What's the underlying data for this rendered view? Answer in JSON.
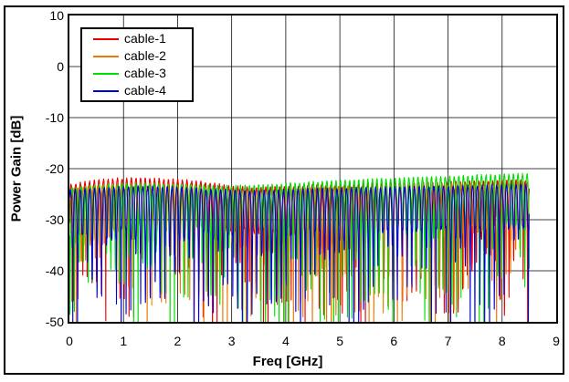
{
  "figure": {
    "background_color": "#ffffff",
    "border_color": "#000000",
    "grid_color": "#000000",
    "text_color": "#000000"
  },
  "chart_data": {
    "type": "line",
    "title": "",
    "xlabel": "Freq [GHz]",
    "ylabel": "Power Gain [dB]",
    "xlim": [
      0,
      9
    ],
    "ylim": [
      -50,
      10
    ],
    "x_ticks": [
      0,
      1,
      2,
      3,
      4,
      5,
      6,
      7,
      8,
      9
    ],
    "y_ticks": [
      10,
      0,
      -10,
      -20,
      -30,
      -40,
      -50
    ],
    "grid": true,
    "legend_position": "top-left",
    "data_x_range_ghz": [
      0,
      8.5
    ],
    "description": "Four cable power-gain traces with dense standing-wave ripple: peaks near -21 to -24 dB, nulls plunging to below -50 dB, ripple period about 0.085 GHz",
    "series": [
      {
        "name": "cable-1",
        "color": "#ee0000",
        "ripple_period_ghz": 0.0857,
        "phase_offset_ghz": 0.012,
        "seed": 101,
        "null_depth_db_range": [
          8,
          33
        ],
        "peak_envelope_db": {
          "x": [
            0,
            0.5,
            1,
            1.5,
            2,
            2.5,
            3,
            3.5,
            4,
            4.5,
            5,
            5.5,
            6,
            6.5,
            7,
            7.5,
            8,
            8.5
          ],
          "y": [
            -23.2,
            -22.3,
            -21.9,
            -22.0,
            -22.2,
            -22.7,
            -23.5,
            -23.8,
            -23.6,
            -23.4,
            -23.2,
            -23.0,
            -22.9,
            -22.8,
            -22.7,
            -22.6,
            -22.4,
            -22.3
          ]
        }
      },
      {
        "name": "cable-2",
        "color": "#f07800",
        "ripple_period_ghz": 0.0873,
        "phase_offset_ghz": 0.047,
        "seed": 202,
        "null_depth_db_range": [
          8,
          33
        ],
        "peak_envelope_db": {
          "x": [
            0,
            0.5,
            1,
            1.5,
            2,
            2.5,
            3,
            3.5,
            4,
            4.5,
            5,
            5.5,
            6,
            6.5,
            7,
            7.5,
            8,
            8.5
          ],
          "y": [
            -24.0,
            -23.5,
            -23.2,
            -23.3,
            -23.4,
            -23.8,
            -24.2,
            -24.3,
            -24.1,
            -23.9,
            -23.7,
            -23.5,
            -23.4,
            -23.2,
            -23.1,
            -23.0,
            -22.9,
            -22.8
          ]
        }
      },
      {
        "name": "cable-3",
        "color": "#00dd00",
        "ripple_period_ghz": 0.0841,
        "phase_offset_ghz": 0.075,
        "seed": 303,
        "null_depth_db_range": [
          8,
          33
        ],
        "peak_envelope_db": {
          "x": [
            0,
            0.5,
            1,
            1.5,
            2,
            2.5,
            3,
            3.5,
            4,
            4.5,
            5,
            5.5,
            6,
            6.5,
            7,
            7.5,
            8,
            8.5
          ],
          "y": [
            -23.8,
            -23.3,
            -23.0,
            -23.0,
            -23.1,
            -23.3,
            -23.5,
            -23.3,
            -23.0,
            -22.7,
            -22.4,
            -22.2,
            -22.0,
            -21.8,
            -21.6,
            -21.4,
            -21.2,
            -21.1
          ]
        }
      },
      {
        "name": "cable-4",
        "color": "#0000dd",
        "ripple_period_ghz": 0.0896,
        "phase_offset_ghz": 0.028,
        "seed": 404,
        "null_depth_db_range": [
          8,
          33
        ],
        "peak_envelope_db": {
          "x": [
            0,
            0.5,
            1,
            1.5,
            2,
            2.5,
            3,
            3.5,
            4,
            4.5,
            5,
            5.5,
            6,
            6.5,
            7,
            7.5,
            8,
            8.5
          ],
          "y": [
            -24.3,
            -23.9,
            -23.6,
            -23.6,
            -23.7,
            -24.0,
            -24.3,
            -24.4,
            -24.2,
            -24.0,
            -23.9,
            -23.8,
            -23.7,
            -23.6,
            -23.5,
            -23.4,
            -23.3,
            -23.2
          ]
        }
      }
    ]
  }
}
